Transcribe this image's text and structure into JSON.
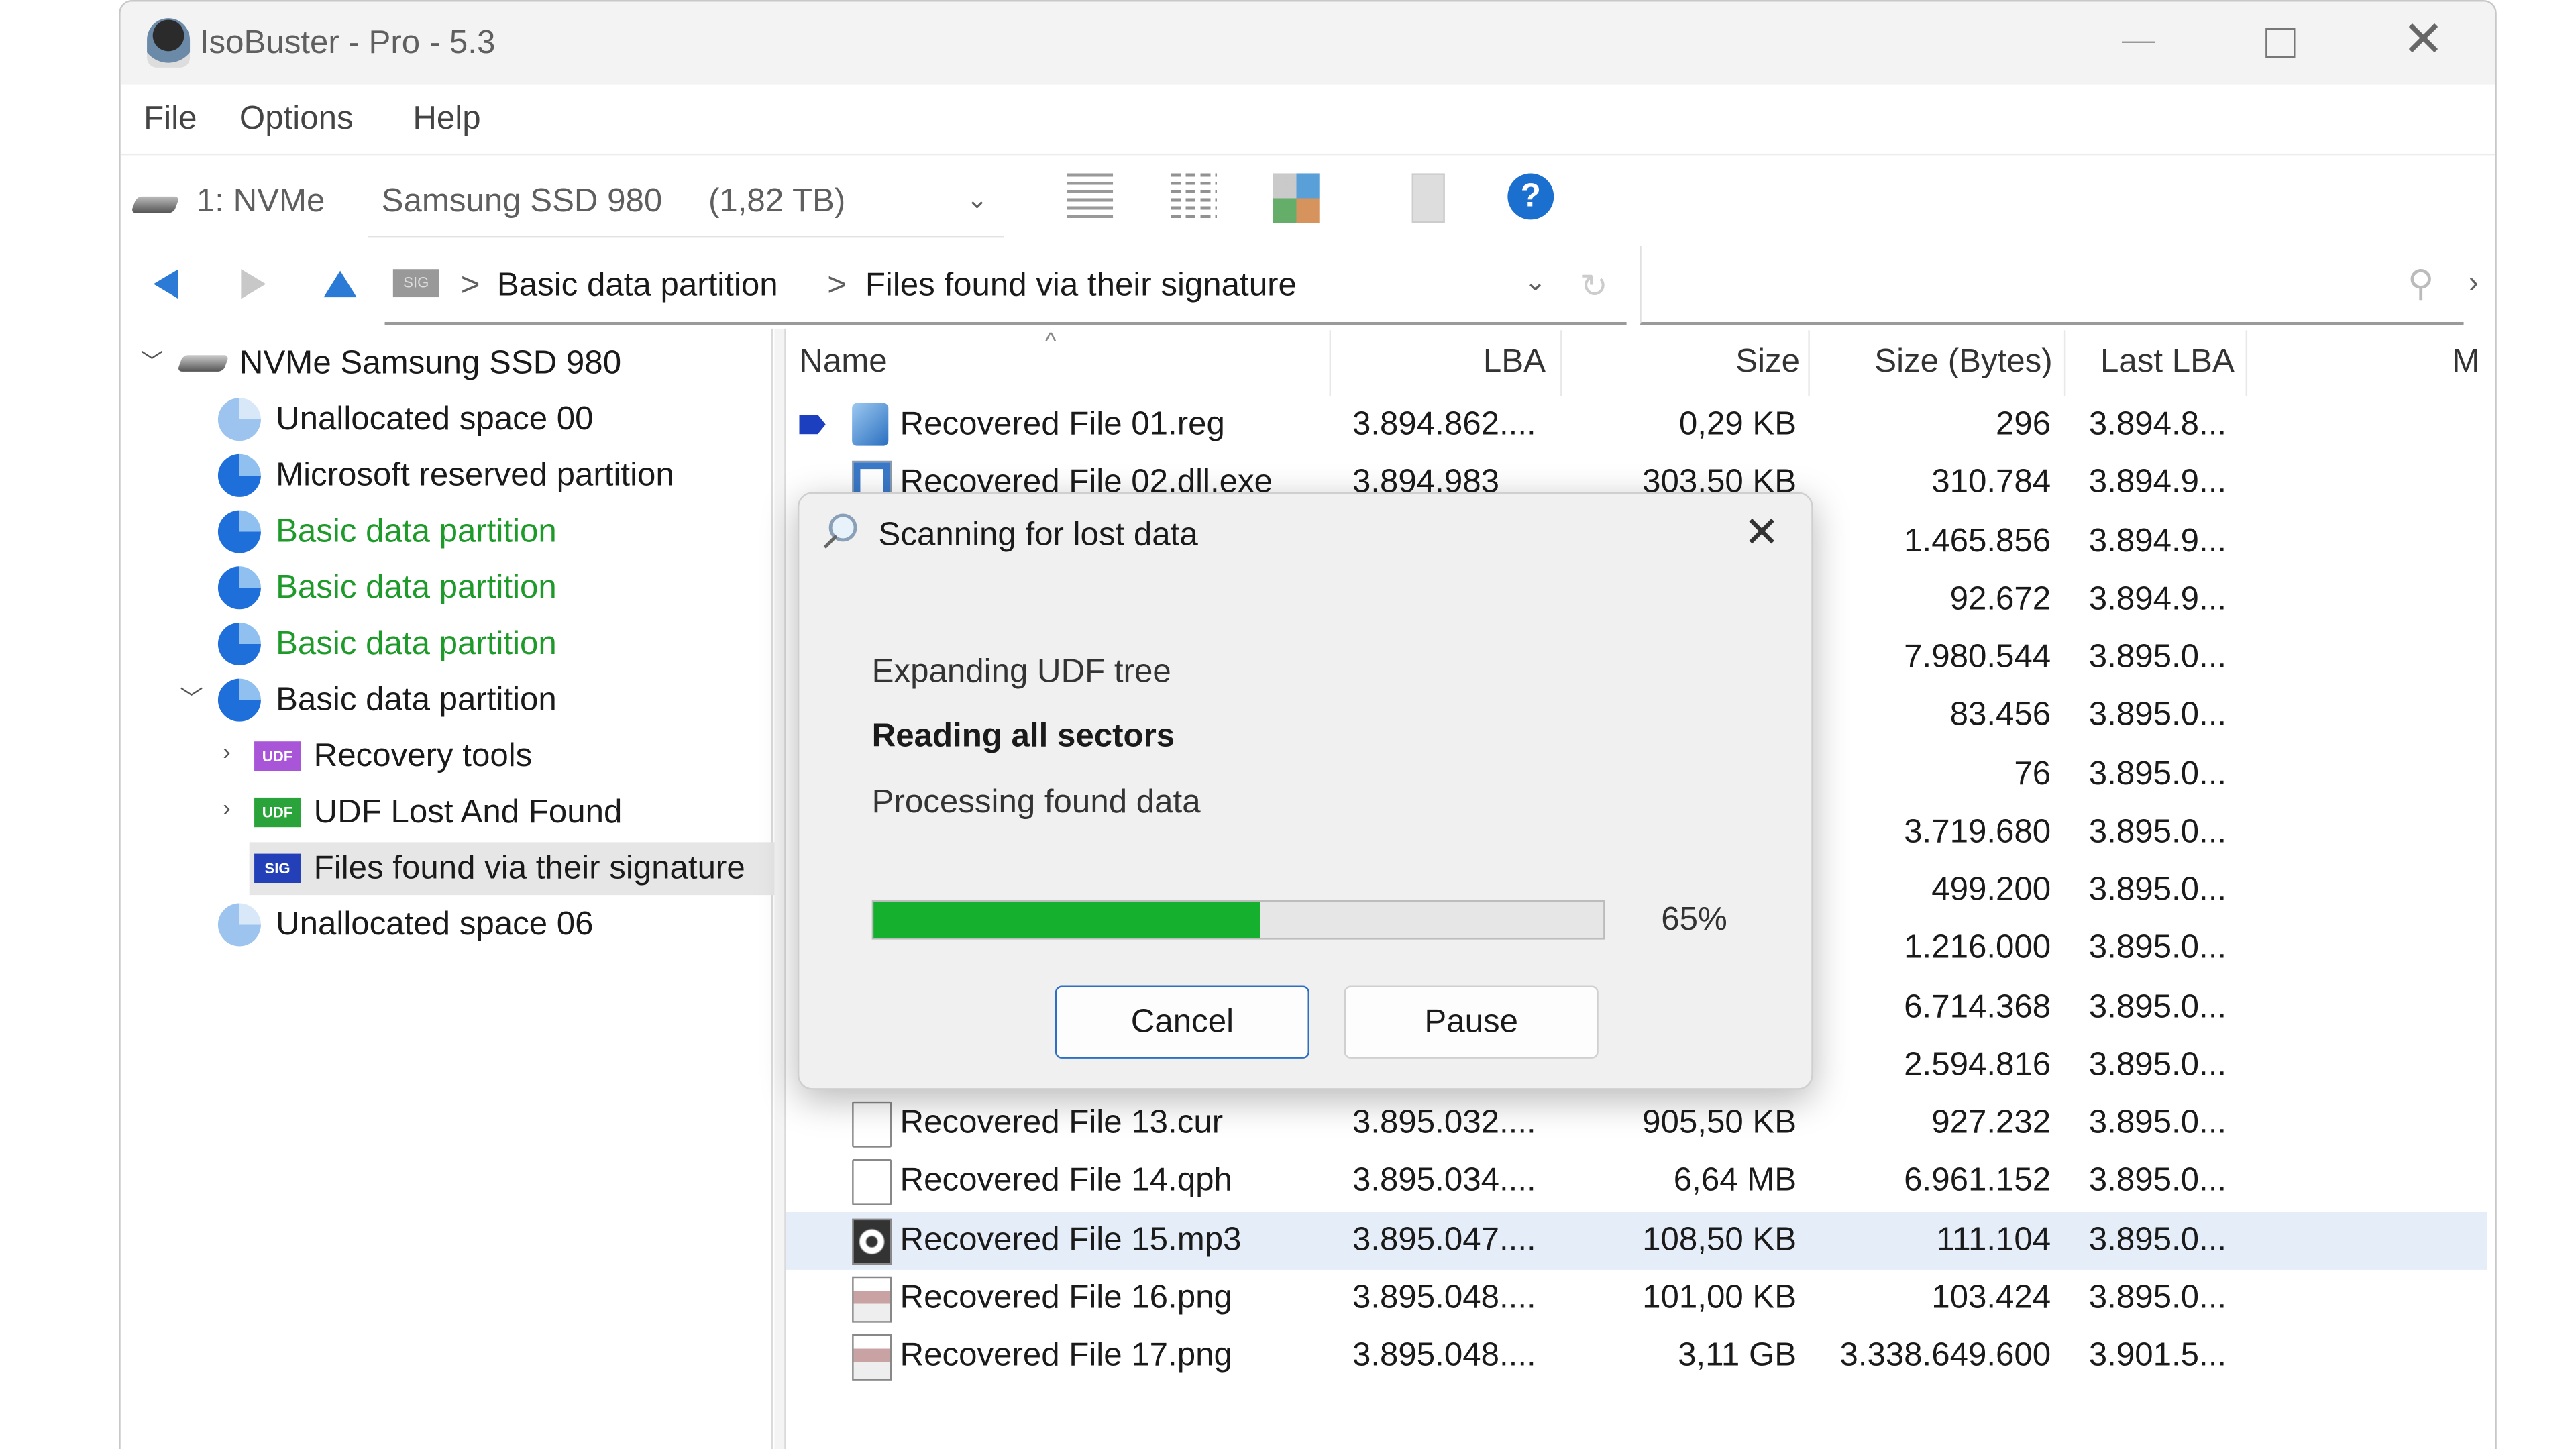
{
  "window": {
    "title": "IsoBuster - Pro - 5.3"
  },
  "menu": [
    "File",
    "Options",
    "Help"
  ],
  "toolbar": {
    "device_id": "1: NVMe",
    "device_name": "Samsung SSD 980",
    "device_size": "(1,82 TB)",
    "icons": [
      "list-view-icon",
      "detail-view-icon",
      "thumbnail-view-icon",
      "extract-icon",
      "help-icon"
    ]
  },
  "nav": {
    "breadcrumb_badge": "SIG",
    "breadcrumb": [
      "Basic data partition",
      "Files found via their signature"
    ],
    "separator": ">"
  },
  "tree": [
    {
      "label": "NVMe Samsung SSD 980",
      "level": 0,
      "expanded": true,
      "icon": "drive-icon"
    },
    {
      "label": "Unallocated space 00",
      "level": 1,
      "icon": "unallocated-icon"
    },
    {
      "label": "Microsoft reserved partition",
      "level": 1,
      "icon": "partition-icon"
    },
    {
      "label": "Basic data partition",
      "level": 1,
      "icon": "partition-icon",
      "color": "#1e9a2a"
    },
    {
      "label": "Basic data partition",
      "level": 1,
      "icon": "partition-icon",
      "color": "#1e9a2a"
    },
    {
      "label": "Basic data partition",
      "level": 1,
      "icon": "partition-icon",
      "color": "#1e9a2a"
    },
    {
      "label": "Basic data partition",
      "level": 1,
      "icon": "partition-icon",
      "expanded": true
    },
    {
      "label": "Recovery tools",
      "level": 2,
      "badge": "UDF",
      "badge_color": "#a855d8"
    },
    {
      "label": "UDF Lost And Found",
      "level": 2,
      "badge": "UDF",
      "badge_color": "#2aa43a"
    },
    {
      "label": "Files found via their signature",
      "level": 2,
      "badge": "SIG",
      "badge_color": "#2340b8",
      "selected": true
    },
    {
      "label": "Unallocated space 06",
      "level": 1,
      "icon": "unallocated-icon"
    }
  ],
  "list": {
    "columns": [
      "Name",
      "LBA",
      "Size",
      "Size (Bytes)",
      "Last LBA",
      "M"
    ],
    "rows": [
      {
        "name": "Recovered File 01.reg",
        "lba": "3.894.862....",
        "size": "0,29 KB",
        "bytes": "296",
        "last": "3.894.8...",
        "icon": "registry-file-icon"
      },
      {
        "name": "Recovered File 02.dll.exe",
        "lba": "3.894.983",
        "size": "303,50 KB",
        "bytes": "310.784",
        "last": "3.894.9...",
        "icon": "exe-file-icon"
      },
      {
        "bytes": "1.465.856",
        "last": "3.894.9..."
      },
      {
        "bytes": "92.672",
        "last": "3.894.9..."
      },
      {
        "bytes": "7.980.544",
        "last": "3.895.0..."
      },
      {
        "bytes": "83.456",
        "last": "3.895.0..."
      },
      {
        "bytes": "76",
        "last": "3.895.0..."
      },
      {
        "bytes": "3.719.680",
        "last": "3.895.0..."
      },
      {
        "bytes": "499.200",
        "last": "3.895.0..."
      },
      {
        "bytes": "1.216.000",
        "last": "3.895.0..."
      },
      {
        "bytes": "6.714.368",
        "last": "3.895.0..."
      },
      {
        "bytes": "2.594.816",
        "last": "3.895.0..."
      },
      {
        "name": "Recovered File 13.cur",
        "lba": "3.895.032....",
        "size": "905,50 KB",
        "bytes": "927.232",
        "last": "3.895.0...",
        "icon": "blank-file-icon"
      },
      {
        "name": "Recovered File 14.qph",
        "lba": "3.895.034....",
        "size": "6,64 MB",
        "bytes": "6.961.152",
        "last": "3.895.0...",
        "icon": "blank-file-icon"
      },
      {
        "name": "Recovered File 15.mp3",
        "lba": "3.895.047....",
        "size": "108,50 KB",
        "bytes": "111.104",
        "last": "3.895.0...",
        "icon": "audio-file-icon",
        "highlighted": true
      },
      {
        "name": "Recovered File 16.png",
        "lba": "3.895.048....",
        "size": "101,00 KB",
        "bytes": "103.424",
        "last": "3.895.0...",
        "icon": "image-file-icon"
      },
      {
        "name": "Recovered File 17.png",
        "lba": "3.895.048....",
        "size": "3,11 GB",
        "bytes": "3.338.649.600",
        "last": "3.901.5...",
        "icon": "image-file-icon"
      }
    ]
  },
  "dialog": {
    "title": "Scanning for lost data",
    "steps": [
      "Expanding UDF tree",
      "Reading all sectors",
      "Processing found data"
    ],
    "active_step": 1,
    "progress_label": "65%",
    "progress_fill_fraction": 0.53,
    "progress_color": "#16b02f",
    "cancel_label": "Cancel",
    "pause_label": "Pause"
  }
}
